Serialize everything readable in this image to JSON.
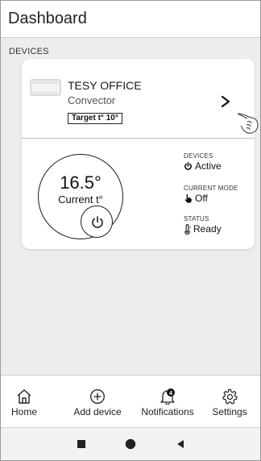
{
  "header": {
    "title": "Dashboard"
  },
  "section": {
    "label": "DEVICES"
  },
  "device": {
    "name": "TESY OFFICE",
    "type": "Convector",
    "target_badge": "Target t° 10°",
    "current_temp": "16.5°",
    "current_temp_label": "Current t°",
    "status": {
      "devices_title": "DEVICES",
      "devices_value": "Active",
      "mode_title": "CURRENT MODE",
      "mode_value": "Off",
      "status_title": "STATUS",
      "status_value": "Ready"
    }
  },
  "bottom_nav": {
    "items": [
      {
        "label": "Home",
        "icon": "home-icon"
      },
      {
        "label": "Add device",
        "icon": "add-circle-icon"
      },
      {
        "label": "Notifications",
        "icon": "bell-icon",
        "badge": "4"
      },
      {
        "label": "Settings",
        "icon": "gear-icon"
      }
    ]
  },
  "system_nav": {
    "icons": [
      "square-stop-icon",
      "circle-home-icon",
      "triangle-back-icon"
    ]
  },
  "colors": {
    "background": "#ededed",
    "card": "#ffffff",
    "text": "#1a1a1a"
  }
}
